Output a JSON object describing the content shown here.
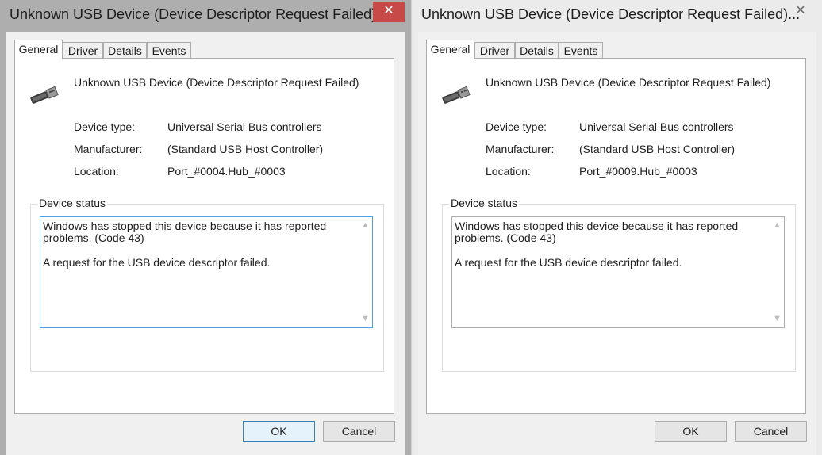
{
  "windows": [
    {
      "title": "Unknown USB Device (Device Descriptor Request Failed)...",
      "close_glyph": "✕",
      "tabs": [
        "General",
        "Driver",
        "Details",
        "Events"
      ],
      "device_name": "Unknown USB Device (Device Descriptor Request Failed)",
      "icon": "usb-plug-icon",
      "properties": [
        {
          "label": "Device type:",
          "value": "Universal Serial Bus controllers"
        },
        {
          "label": "Manufacturer:",
          "value": "(Standard USB Host Controller)"
        },
        {
          "label": "Location:",
          "value": "Port_#0004.Hub_#0003"
        }
      ],
      "status_group_label": "Device status",
      "status_line1": "Windows has stopped this device because it has reported problems. (Code 43)",
      "status_line2": "A request for the USB device descriptor failed.",
      "ok_label": "OK",
      "cancel_label": "Cancel",
      "state": "active"
    },
    {
      "title": "Unknown USB Device (Device Descriptor Request Failed)...",
      "close_glyph": "✕",
      "tabs": [
        "General",
        "Driver",
        "Details",
        "Events"
      ],
      "device_name": "Unknown USB Device (Device Descriptor Request Failed)",
      "icon": "usb-plug-icon",
      "properties": [
        {
          "label": "Device type:",
          "value": "Universal Serial Bus controllers"
        },
        {
          "label": "Manufacturer:",
          "value": "(Standard USB Host Controller)"
        },
        {
          "label": "Location:",
          "value": "Port_#0009.Hub_#0003"
        }
      ],
      "status_group_label": "Device status",
      "status_line1": "Windows has stopped this device because it has reported problems. (Code 43)",
      "status_line2": "A request for the USB device descriptor failed.",
      "ok_label": "OK",
      "cancel_label": "Cancel",
      "state": "inactive"
    }
  ],
  "colors": {
    "close_active": "#c74a47",
    "focus_border": "#569de5",
    "default_button_border": "#3c7fb1"
  }
}
